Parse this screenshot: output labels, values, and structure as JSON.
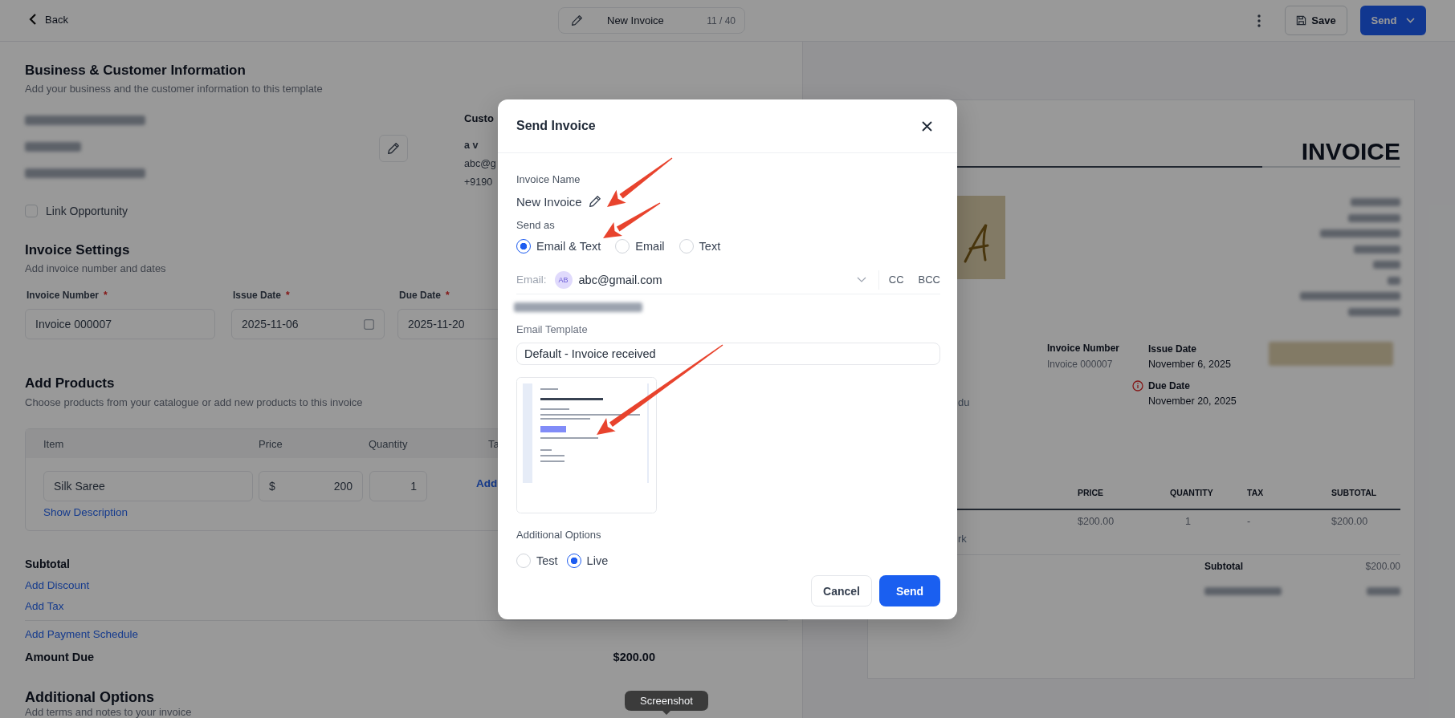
{
  "top_bar": {
    "back": "Back",
    "document_title": "New Invoice",
    "counter": "11 / 40",
    "save": "Save",
    "send": "Send"
  },
  "business_section": {
    "title": "Business & Customer Information",
    "subtitle": "Add your business and the customer information to this template",
    "business_details": [
      {
        "kind": "redacted"
      },
      {
        "kind": "redacted"
      },
      {
        "kind": "redacted"
      }
    ],
    "customer_heading": "Custo",
    "customer_name": "a v",
    "customer_email": "abc@g",
    "customer_phone": "+9190",
    "link_opportunity": {
      "label": "Link Opportunity",
      "checked": false
    }
  },
  "invoice_settings": {
    "title": "Invoice Settings",
    "subtitle": "Add invoice number and dates",
    "fields": [
      {
        "kind": "text",
        "label": "Invoice Number",
        "required_mark": "*",
        "value": "Invoice 000007"
      },
      {
        "kind": "date",
        "label": "Issue Date",
        "required_mark": "*",
        "value": "2025-11-06"
      },
      {
        "kind": "text",
        "label": "Due Date",
        "required_mark": "*",
        "value": "2025-11-20"
      }
    ]
  },
  "products": {
    "title": "Add Products",
    "subtitle": "Choose products from your catalogue or add new products to this invoice",
    "columns": [
      "Item",
      "Price",
      "Quantity",
      "Ta"
    ],
    "rows": [
      {
        "item": "Silk Saree",
        "currency": "$",
        "price": "200",
        "quantity": "1",
        "tax_link": "Add",
        "description_link": "Show Description"
      }
    ]
  },
  "totals": {
    "subtotal_label": "Subtotal",
    "links": [
      "Add Discount",
      "Add Tax"
    ],
    "payment_schedule_link": "Add Payment Schedule",
    "amount_due_label": "Amount Due",
    "amount_due": "$200.00"
  },
  "additional_options": {
    "title": "Additional Options",
    "subtitle": "Add terms and notes to your invoice"
  },
  "preview": {
    "heading": "INVOICE",
    "logo": {
      "kind": "logo"
    },
    "business_address": [
      {
        "kind": "redacted"
      },
      {
        "kind": "redacted"
      },
      {
        "kind": "redacted"
      },
      {
        "kind": "redacted"
      },
      {
        "kind": "redacted"
      },
      {
        "kind": "redacted"
      },
      {
        "kind": "redacted"
      },
      {
        "kind": "redacted"
      }
    ],
    "invoice_number_label": "Invoice Number",
    "invoice_number": "Invoice 000007",
    "issue_date_label": "Issue Date",
    "issue_date": "November 6, 2025",
    "due_date_label": "Due Date",
    "due_date": "November 20, 2025",
    "pay_button": {
      "kind": "redacted"
    },
    "customer_fragment": "du",
    "columns": [
      "PRICE",
      "QUANTITY",
      "TAX",
      "SUBTOTAL"
    ],
    "rows": [
      {
        "price": "$200.00",
        "quantity": "1",
        "tax": "-",
        "subtotal": "$200.00",
        "description_fragment": "rk"
      }
    ],
    "subtotal_label": "Subtotal",
    "subtotal": "$200.00",
    "amount_due": {
      "kind": "redacted"
    }
  },
  "modal": {
    "title": "Send Invoice",
    "invoice_name_label": "Invoice Name",
    "invoice_name": "New Invoice",
    "send_as_label": "Send as",
    "send_as_options": [
      {
        "label": "Email & Text",
        "selected": true
      },
      {
        "label": "Email",
        "selected": false
      },
      {
        "label": "Text",
        "selected": false
      }
    ],
    "email_label": "Email:",
    "recipient_initials": "AB",
    "recipient_email": "abc@gmail.com",
    "cc": "CC",
    "bcc": "BCC",
    "phone": {
      "kind": "redacted"
    },
    "email_template_label": "Email Template",
    "email_template": "Default - Invoice received",
    "template_preview": {
      "kind": "drawing"
    },
    "additional_options_label": "Additional Options",
    "mode_options": [
      {
        "label": "Test",
        "selected": false
      },
      {
        "label": "Live",
        "selected": true
      }
    ],
    "cancel": "Cancel",
    "send": "Send"
  },
  "annotations": [
    {
      "kind": "arrow"
    },
    {
      "kind": "arrow"
    },
    {
      "kind": "arrow"
    }
  ],
  "tooltip": "Screenshot"
}
